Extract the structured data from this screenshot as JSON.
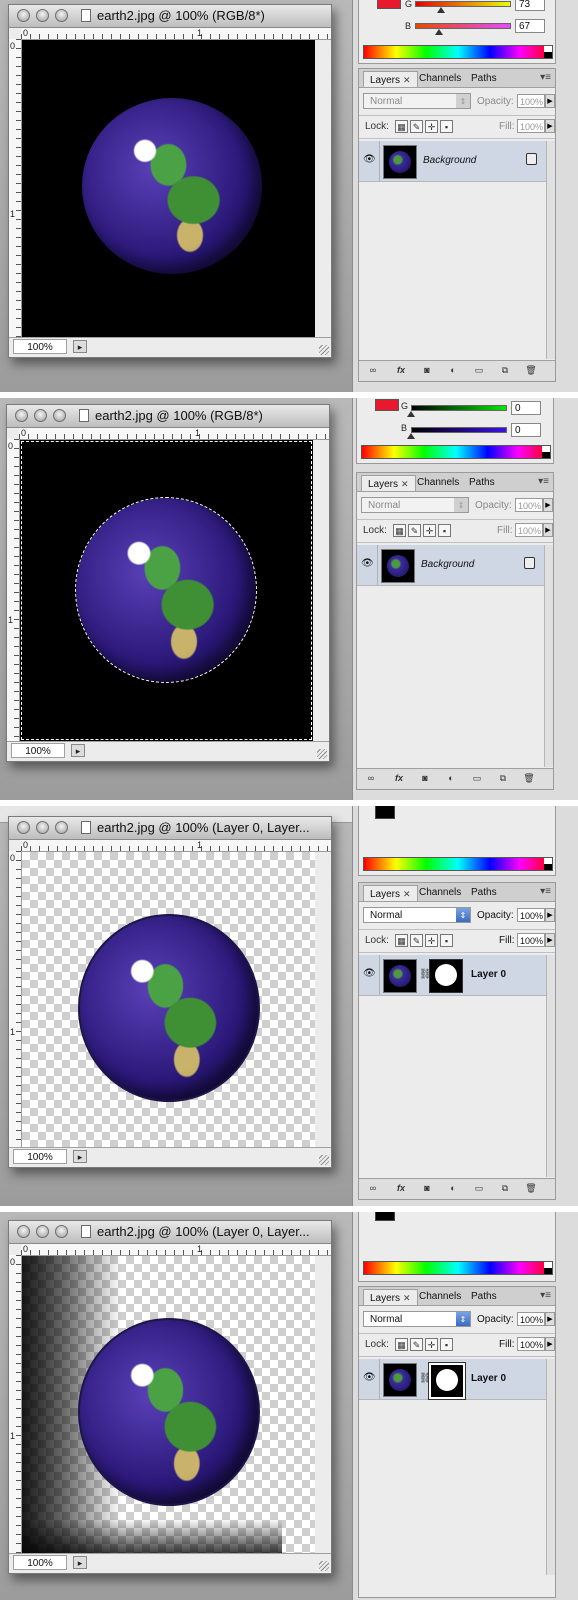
{
  "panels": [
    {
      "window_title": "earth2.jpg @ 100% (RGB/8*)",
      "zoom": "100%",
      "ruler_h": [
        "0",
        "1"
      ],
      "ruler_v": [
        "0",
        "1"
      ],
      "color": {
        "g_label": "G",
        "g_value": "73",
        "b_label": "B",
        "b_value": "67",
        "foreground": "#e8192c"
      },
      "layers": {
        "tabs": [
          "Layers",
          "Channels",
          "Paths"
        ],
        "blend_mode": "Normal",
        "opacity_label": "Opacity:",
        "opacity_value": "100%",
        "lock_label": "Lock:",
        "fill_label": "Fill:",
        "fill_value": "100%",
        "layer_name": "Background"
      }
    },
    {
      "window_title": "earth2.jpg @ 100% (RGB/8*)",
      "zoom": "100%",
      "ruler_h": [
        "0",
        "1"
      ],
      "ruler_v": [
        "0",
        "1"
      ],
      "color": {
        "g_label": "G",
        "g_value": "0",
        "b_label": "B",
        "b_value": "0",
        "foreground": "#e8192c"
      },
      "layers": {
        "tabs": [
          "Layers",
          "Channels",
          "Paths"
        ],
        "blend_mode": "Normal",
        "opacity_label": "Opacity:",
        "opacity_value": "100%",
        "lock_label": "Lock:",
        "fill_label": "Fill:",
        "fill_value": "100%",
        "layer_name": "Background"
      }
    },
    {
      "window_title": "earth2.jpg @ 100% (Layer 0, Layer...",
      "zoom": "100%",
      "ruler_h": [
        "0",
        "1"
      ],
      "ruler_v": [
        "0",
        "1"
      ],
      "layers": {
        "tabs": [
          "Layers",
          "Channels",
          "Paths"
        ],
        "blend_mode": "Normal",
        "opacity_label": "Opacity:",
        "opacity_value": "100%",
        "lock_label": "Lock:",
        "fill_label": "Fill:",
        "fill_value": "100%",
        "layer_name": "Layer 0"
      }
    },
    {
      "window_title": "earth2.jpg @ 100% (Layer 0, Layer...",
      "zoom": "100%",
      "ruler_h": [
        "0",
        "1"
      ],
      "ruler_v": [
        "0",
        "1"
      ],
      "layers": {
        "tabs": [
          "Layers",
          "Channels",
          "Paths"
        ],
        "blend_mode": "Normal",
        "opacity_label": "Opacity:",
        "opacity_value": "100%",
        "lock_label": "Lock:",
        "fill_label": "Fill:",
        "fill_value": "100%",
        "layer_name": "Layer 0"
      }
    }
  ],
  "icons": {
    "eye": "eye-icon",
    "link": "link-layers-icon",
    "fx": "layer-style-icon",
    "mask": "add-mask-icon",
    "adjust": "adjustment-layer-icon",
    "folder": "new-group-icon",
    "new": "new-layer-icon",
    "trash": "delete-layer-icon"
  }
}
